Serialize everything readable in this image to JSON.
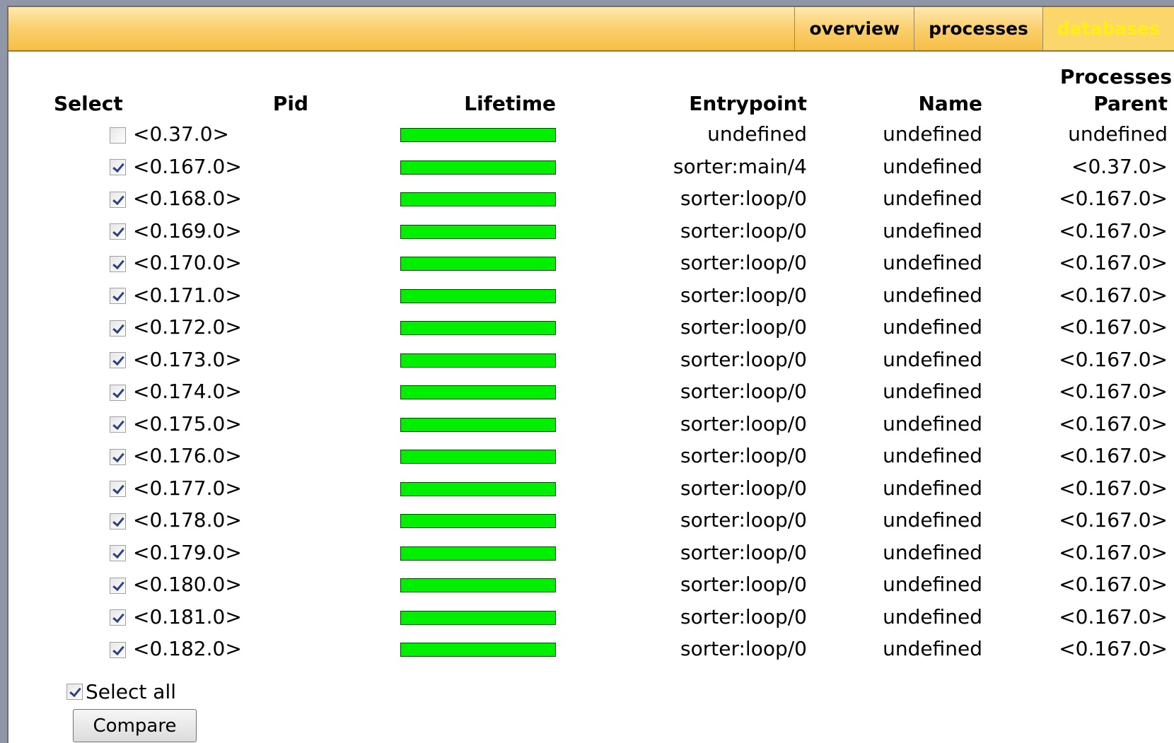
{
  "nav": {
    "items": [
      {
        "label": "overview"
      },
      {
        "label": "processes"
      },
      {
        "label": "databases"
      }
    ]
  },
  "table": {
    "caption": "Processes",
    "headers": {
      "select": "Select",
      "pid": "Pid",
      "lifetime": "Lifetime",
      "entrypoint": "Entrypoint",
      "name": "Name",
      "parent": "Parent"
    },
    "rows": [
      {
        "checked": false,
        "pid": "<0.37.0>",
        "entrypoint": "undefined",
        "name": "undefined",
        "parent": "undefined",
        "lifetime": 1.0
      },
      {
        "checked": true,
        "pid": "<0.167.0>",
        "entrypoint": "sorter:main/4",
        "name": "undefined",
        "parent": "<0.37.0>",
        "lifetime": 1.0
      },
      {
        "checked": true,
        "pid": "<0.168.0>",
        "entrypoint": "sorter:loop/0",
        "name": "undefined",
        "parent": "<0.167.0>",
        "lifetime": 1.0
      },
      {
        "checked": true,
        "pid": "<0.169.0>",
        "entrypoint": "sorter:loop/0",
        "name": "undefined",
        "parent": "<0.167.0>",
        "lifetime": 1.0
      },
      {
        "checked": true,
        "pid": "<0.170.0>",
        "entrypoint": "sorter:loop/0",
        "name": "undefined",
        "parent": "<0.167.0>",
        "lifetime": 1.0
      },
      {
        "checked": true,
        "pid": "<0.171.0>",
        "entrypoint": "sorter:loop/0",
        "name": "undefined",
        "parent": "<0.167.0>",
        "lifetime": 1.0
      },
      {
        "checked": true,
        "pid": "<0.172.0>",
        "entrypoint": "sorter:loop/0",
        "name": "undefined",
        "parent": "<0.167.0>",
        "lifetime": 1.0
      },
      {
        "checked": true,
        "pid": "<0.173.0>",
        "entrypoint": "sorter:loop/0",
        "name": "undefined",
        "parent": "<0.167.0>",
        "lifetime": 1.0
      },
      {
        "checked": true,
        "pid": "<0.174.0>",
        "entrypoint": "sorter:loop/0",
        "name": "undefined",
        "parent": "<0.167.0>",
        "lifetime": 1.0
      },
      {
        "checked": true,
        "pid": "<0.175.0>",
        "entrypoint": "sorter:loop/0",
        "name": "undefined",
        "parent": "<0.167.0>",
        "lifetime": 1.0
      },
      {
        "checked": true,
        "pid": "<0.176.0>",
        "entrypoint": "sorter:loop/0",
        "name": "undefined",
        "parent": "<0.167.0>",
        "lifetime": 1.0
      },
      {
        "checked": true,
        "pid": "<0.177.0>",
        "entrypoint": "sorter:loop/0",
        "name": "undefined",
        "parent": "<0.167.0>",
        "lifetime": 1.0
      },
      {
        "checked": true,
        "pid": "<0.178.0>",
        "entrypoint": "sorter:loop/0",
        "name": "undefined",
        "parent": "<0.167.0>",
        "lifetime": 1.0
      },
      {
        "checked": true,
        "pid": "<0.179.0>",
        "entrypoint": "sorter:loop/0",
        "name": "undefined",
        "parent": "<0.167.0>",
        "lifetime": 1.0
      },
      {
        "checked": true,
        "pid": "<0.180.0>",
        "entrypoint": "sorter:loop/0",
        "name": "undefined",
        "parent": "<0.167.0>",
        "lifetime": 1.0
      },
      {
        "checked": true,
        "pid": "<0.181.0>",
        "entrypoint": "sorter:loop/0",
        "name": "undefined",
        "parent": "<0.167.0>",
        "lifetime": 1.0
      },
      {
        "checked": true,
        "pid": "<0.182.0>",
        "entrypoint": "sorter:loop/0",
        "name": "undefined",
        "parent": "<0.167.0>",
        "lifetime": 1.0
      }
    ]
  },
  "controls": {
    "select_all_label": "Select all",
    "select_all_checked": true,
    "compare_label": "Compare"
  },
  "colors": {
    "lifetime_bar": "#00f000",
    "active_tab_text": "#ffef16"
  }
}
